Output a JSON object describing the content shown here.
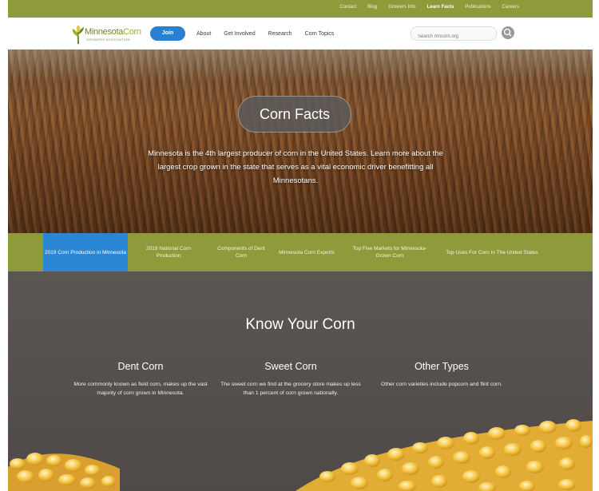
{
  "topbar": {
    "links": [
      {
        "label": "Contact",
        "bold": false
      },
      {
        "label": "Blog",
        "bold": false
      },
      {
        "label": "Growers Info",
        "bold": false
      },
      {
        "label": "Learn Facts",
        "bold": true
      },
      {
        "label": "Publications",
        "bold": false
      },
      {
        "label": "Careers",
        "bold": false
      }
    ]
  },
  "header": {
    "logo": {
      "name_part1": "Minnesota",
      "name_part2": "Corn",
      "subtitle": "GROWERS ASSOCIATION"
    },
    "join_label": "Join",
    "nav": [
      "About",
      "Get Involved",
      "Research",
      "Corn Topics"
    ],
    "search_placeholder": "Search mncorn.org"
  },
  "hero": {
    "title": "Corn Facts",
    "description": "Minnesota is the 4th largest producer of corn in the United States. Learn more about the largest crop grown in the state that serves as a vital economic driver benefitting all Minnesotans."
  },
  "tabs": [
    {
      "label": "2019 Corn Production in Minnesota",
      "active": true
    },
    {
      "label": "2019 National Corn Production",
      "active": false
    },
    {
      "label": "Components of Dent Corn",
      "active": false
    },
    {
      "label": "Minnesota Corn Exports",
      "active": false
    },
    {
      "label": "Top Five Markets for Minnesota-Grown Corn",
      "active": false
    },
    {
      "label": "Top Uses For Corn In The United States",
      "active": false
    }
  ],
  "know": {
    "title": "Know Your Corn",
    "columns": [
      {
        "heading": "Dent Corn",
        "text": "More commonly known as field corn, makes up the vast majority of corn grown in Minnesota."
      },
      {
        "heading": "Sweet Corn",
        "text": "The sweet corn we find at the grocery store makes up less than 1 percent of corn grown nationally."
      },
      {
        "heading": "Other Types",
        "text": "Other corn varieties include popcorn and flint corn."
      }
    ]
  },
  "colors": {
    "olive": "#8f9a3a",
    "blue": "#2b86d3",
    "dark": "#5b5653",
    "corn": "#f4c542"
  }
}
